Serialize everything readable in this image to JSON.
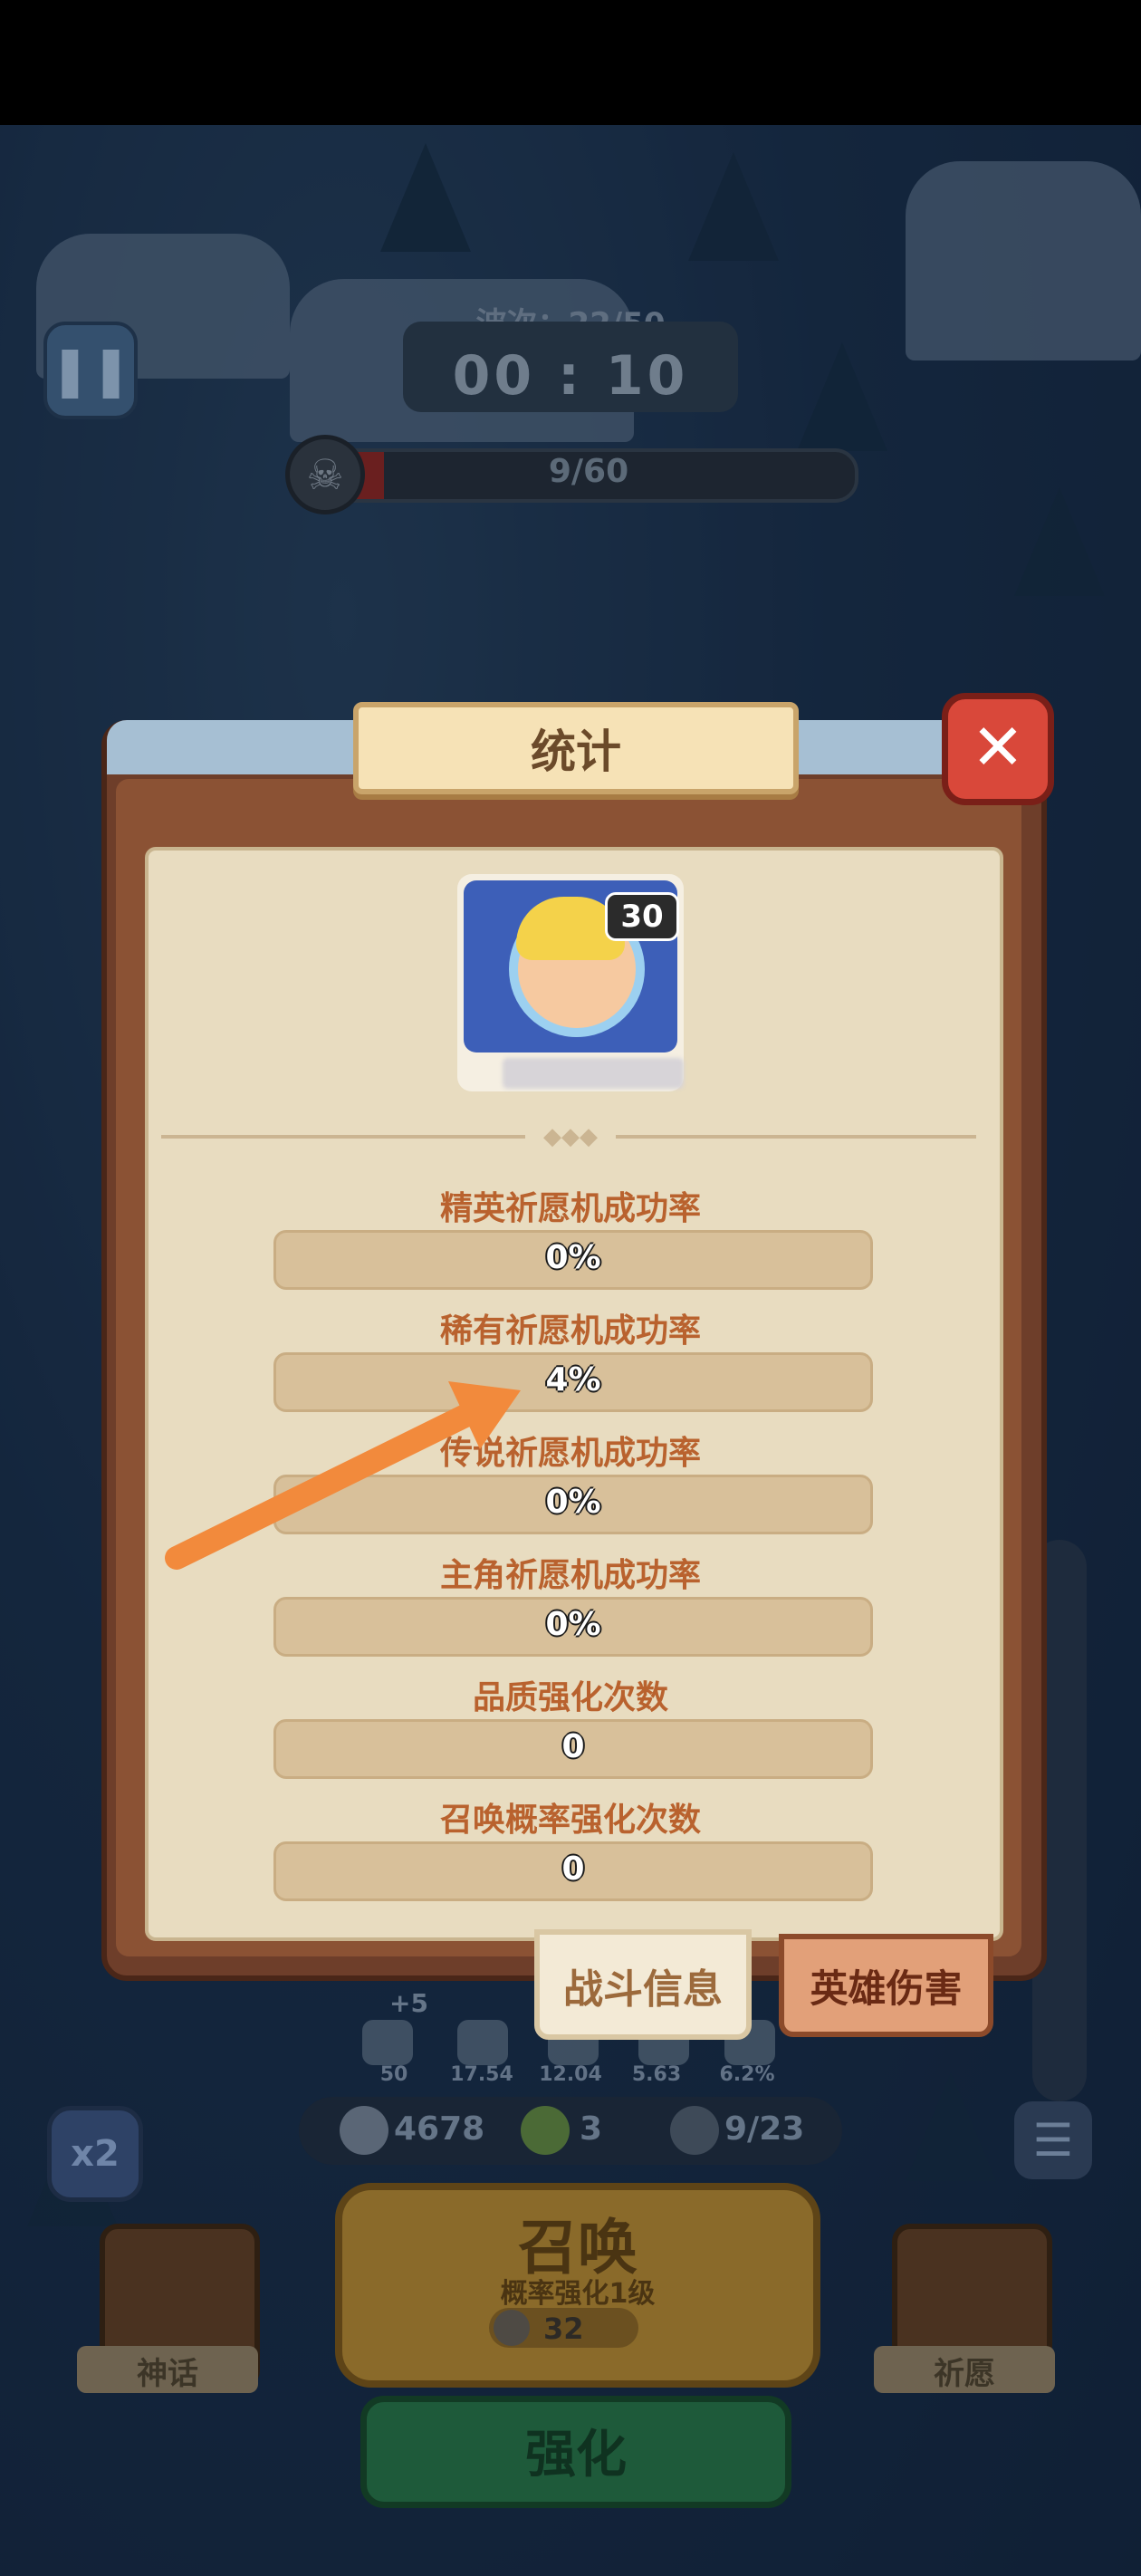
{
  "hud": {
    "wave": "波次：22/50",
    "timer": "00 : 10",
    "boss_count": "9/60",
    "pause_icon": "pause-icon",
    "speed": "x2"
  },
  "dialog": {
    "title": "统计",
    "hero_level": "30",
    "stats": [
      {
        "label": "精英祈愿机成功率",
        "value": "0%"
      },
      {
        "label": "稀有祈愿机成功率",
        "value": "4%"
      },
      {
        "label": "传说祈愿机成功率",
        "value": "0%"
      },
      {
        "label": "主角祈愿机成功率",
        "value": "0%"
      },
      {
        "label": "品质强化次数",
        "value": "0"
      },
      {
        "label": "召唤概率强化次数",
        "value": "0"
      }
    ],
    "tabs": {
      "battle_info": "战斗信息",
      "hero_damage": "英雄伤害"
    }
  },
  "bottom": {
    "stat_plus": "+5",
    "stat_values": [
      "50",
      "17.54",
      "12.04",
      "5.63",
      "6.2%"
    ],
    "silver": "4678",
    "clover": "3",
    "units": "9/23",
    "summon_title": "召唤",
    "summon_sub": "概率强化1级",
    "summon_cost": "32",
    "enhance": "强化",
    "left_card": "神话",
    "right_card": "祈愿"
  },
  "colors": {
    "accent_arrow": "#f28a3c",
    "panel_bg": "#e8dcc0",
    "label_text": "#b9622e"
  }
}
